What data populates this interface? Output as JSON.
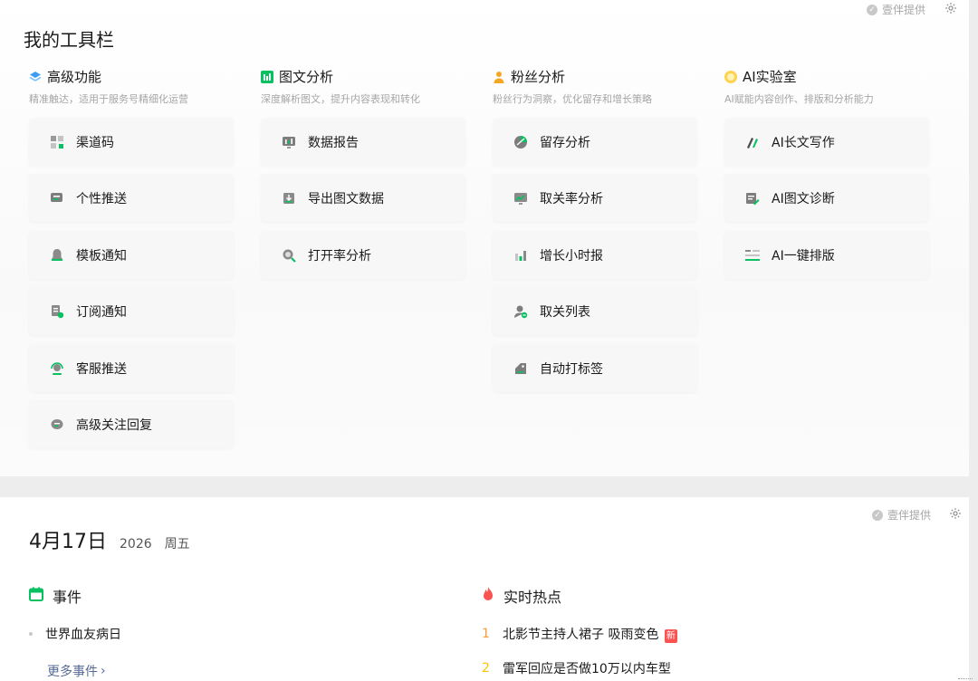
{
  "toolbar": {
    "title": "我的工具栏",
    "provider": "壹伴提供",
    "columns": [
      {
        "title": "高级功能",
        "subtitle": "精准触达，适用于服务号精细化运营",
        "icon": "layers-icon",
        "items": [
          {
            "label": "渠道码",
            "icon": "qrcode-icon"
          },
          {
            "label": "个性推送",
            "icon": "chat-push-icon"
          },
          {
            "label": "模板通知",
            "icon": "bell-icon"
          },
          {
            "label": "订阅通知",
            "icon": "subscribe-doc-icon"
          },
          {
            "label": "客服推送",
            "icon": "headset-icon"
          },
          {
            "label": "高级关注回复",
            "icon": "reply-bubble-icon"
          }
        ]
      },
      {
        "title": "图文分析",
        "subtitle": "深度解析图文，提升内容表现和转化",
        "icon": "bar-chart-icon",
        "items": [
          {
            "label": "数据报告",
            "icon": "report-icon"
          },
          {
            "label": "导出图文数据",
            "icon": "export-icon"
          },
          {
            "label": "打开率分析",
            "icon": "magnifier-chart-icon"
          }
        ]
      },
      {
        "title": "粉丝分析",
        "subtitle": "粉丝行为洞察，优化留存和增长策略",
        "icon": "user-icon",
        "items": [
          {
            "label": "留存分析",
            "icon": "pie-icon"
          },
          {
            "label": "取关率分析",
            "icon": "trend-monitor-icon"
          },
          {
            "label": "增长小时报",
            "icon": "growth-bars-icon"
          },
          {
            "label": "取关列表",
            "icon": "user-minus-icon"
          },
          {
            "label": "自动打标签",
            "icon": "tag-icon"
          }
        ]
      },
      {
        "title": "AI实验室",
        "subtitle": "AI赋能内容创作、排版和分析能力",
        "icon": "ai-badge-icon",
        "items": [
          {
            "label": "AI长文写作",
            "icon": "ai-write-icon"
          },
          {
            "label": "AI图文诊断",
            "icon": "ai-diagnose-icon"
          },
          {
            "label": "AI一键排版",
            "icon": "ai-layout-icon"
          }
        ]
      }
    ]
  },
  "calendar": {
    "provider": "壹伴提供",
    "date": "4月17日",
    "year": "2026",
    "weekday": "周五",
    "events_title": "事件",
    "events": [
      "世界血友病日"
    ],
    "more_events": "更多事件",
    "hot_title": "实时热点",
    "hot_items": [
      {
        "rank": "1",
        "text": "北影节主持人裙子 吸雨变色",
        "badge": "新"
      },
      {
        "rank": "2",
        "text": "雷军回应是否做10万以内车型",
        "badge": ""
      }
    ]
  },
  "colors": {
    "accent_green": "#07c160",
    "hot_red": "#fa5151",
    "link_blue": "#576b95",
    "rank1": "#fa9d3b",
    "rank2": "#ffc300"
  }
}
